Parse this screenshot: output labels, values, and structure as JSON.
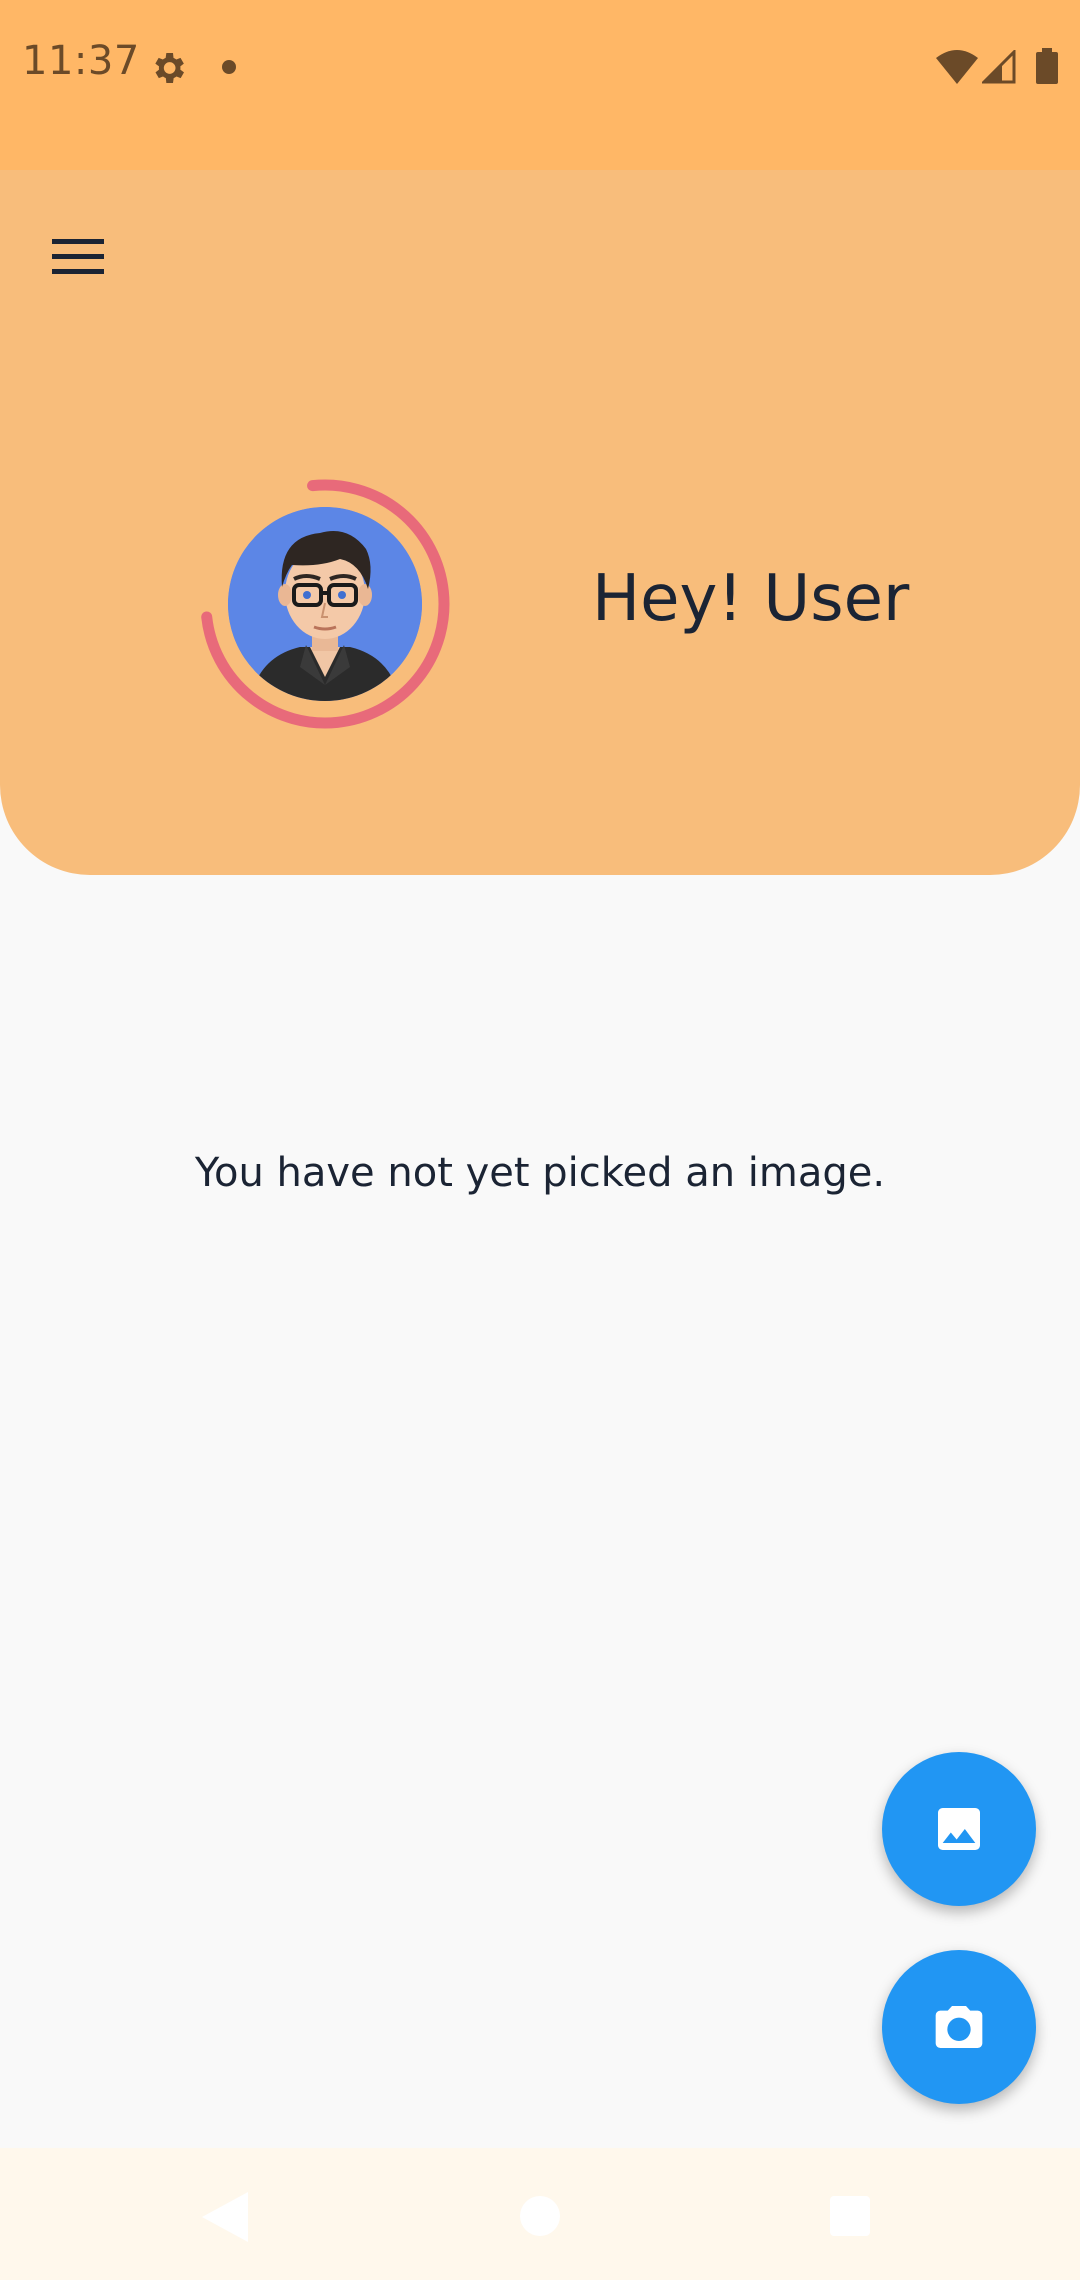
{
  "status_bar": {
    "time": "11:37",
    "icons": [
      "gear-icon",
      "dot-icon",
      "wifi-icon",
      "signal-icon",
      "battery-icon"
    ]
  },
  "header": {
    "menu_icon": "hamburger-menu-icon",
    "greeting": "Hey! User",
    "avatar": "user-avatar",
    "colors": {
      "background": "#f8bd7b",
      "ring": "#e86a7a",
      "avatar_bg": "#5c86e6"
    }
  },
  "main": {
    "empty_message": "You have not yet picked an image."
  },
  "fabs": [
    {
      "icon": "image-icon",
      "name": "pick-from-gallery"
    },
    {
      "icon": "camera-icon",
      "name": "take-photo"
    }
  ],
  "nav_bar": {
    "icons": [
      "back-icon",
      "home-icon",
      "recents-icon"
    ]
  },
  "colors": {
    "status_bar": "#ffb766",
    "accent": "#2196f3",
    "text": "#1b2434",
    "page_bg": "#f9f9f9"
  }
}
